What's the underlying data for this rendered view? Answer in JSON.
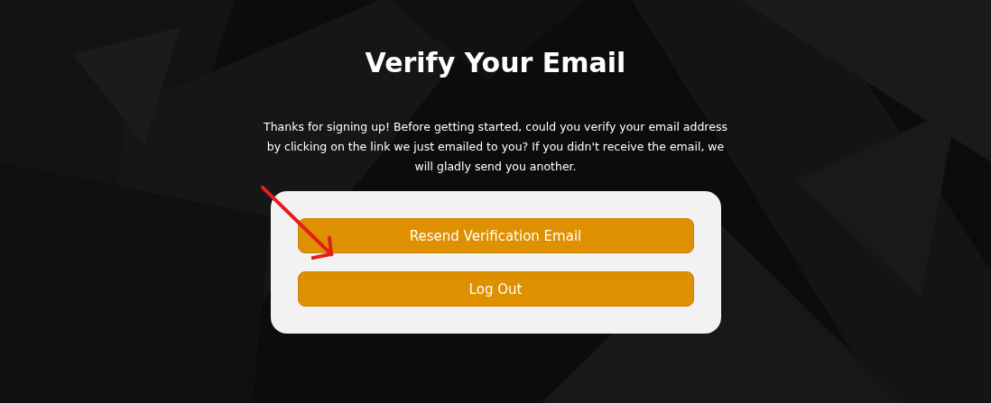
{
  "title": "Verify Your Email",
  "message": "Thanks for signing up! Before getting started, could you verify your email address by clicking on the link we just emailed to you? If you didn't receive the email, we will gladly send you another.",
  "buttons": [
    {
      "label": "Resend Verification Email"
    },
    {
      "label": "Log Out"
    }
  ]
}
